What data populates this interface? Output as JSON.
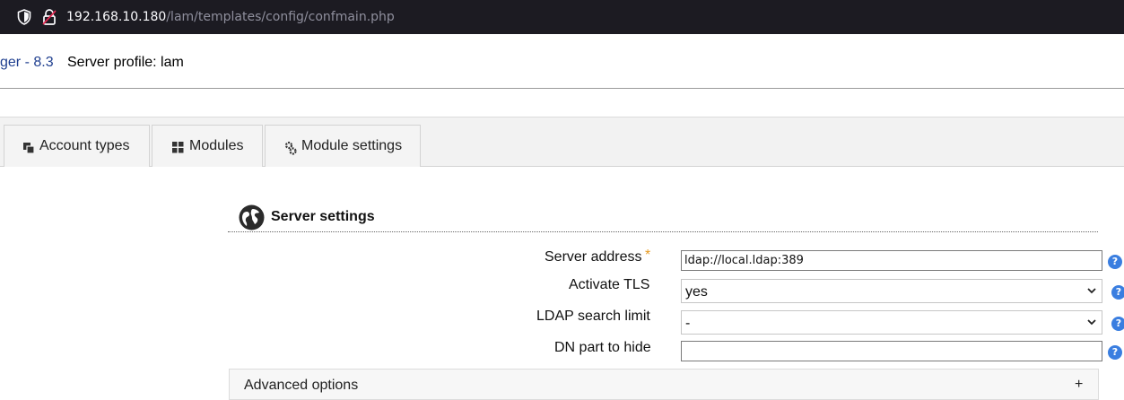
{
  "browser": {
    "url_host": "192.168.10.180",
    "url_path": "/lam/templates/config/confmain.php",
    "icons": [
      "shield-icon",
      "lock-icon"
    ]
  },
  "header": {
    "app_title": "ger - 8.3",
    "profile_label": "Server profile: lam"
  },
  "tabs": [
    {
      "label": "Account types",
      "icon": "account-types-icon"
    },
    {
      "label": "Modules",
      "icon": "grid-icon"
    },
    {
      "label": "Module settings",
      "icon": "gears-icon"
    }
  ],
  "server_settings": {
    "title": "Server settings",
    "icon": "globe-icon",
    "fields": {
      "server_address": {
        "label": "Server address",
        "required_mark": "*",
        "value": "ldap://local.ldap:389"
      },
      "activate_tls": {
        "label": "Activate TLS",
        "value": "yes"
      },
      "search_limit": {
        "label": "LDAP search limit",
        "value": "-"
      },
      "dn_hide": {
        "label": "DN part to hide",
        "value": ""
      }
    },
    "help_glyph": "?"
  },
  "advanced": {
    "label": "Advanced options",
    "toggle": "+"
  },
  "colors": {
    "accent_blue": "#3a7ee0",
    "required_orange": "#e69b23",
    "header_link": "#1f3f8f"
  }
}
